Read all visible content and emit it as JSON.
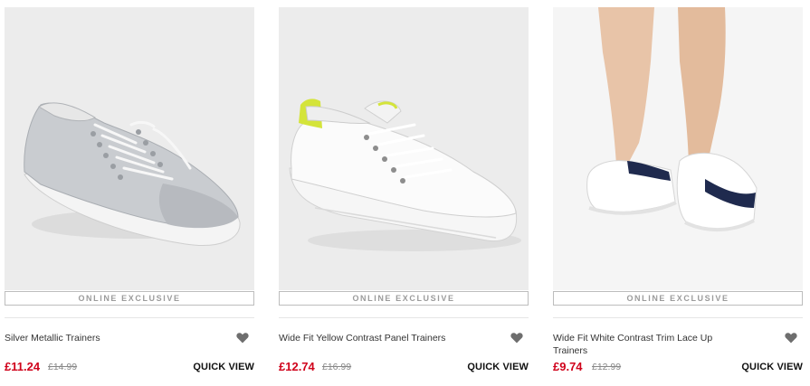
{
  "products": [
    {
      "badge": "ONLINE EXCLUSIVE",
      "title": "Silver Metallic Trainers",
      "price_now": "£11.24",
      "price_was": "£14.99",
      "quick_view": "QUICK VIEW",
      "wishlist_icon": "heart-icon"
    },
    {
      "badge": "ONLINE EXCLUSIVE",
      "title": "Wide Fit Yellow Contrast Panel Trainers",
      "price_now": "£12.74",
      "price_was": "£16.99",
      "quick_view": "QUICK VIEW",
      "wishlist_icon": "heart-icon"
    },
    {
      "badge": "ONLINE EXCLUSIVE",
      "title": "Wide Fit White Contrast Trim Lace Up Trainers",
      "price_now": "£9.74",
      "price_was": "£12.99",
      "quick_view": "QUICK VIEW",
      "wishlist_icon": "heart-icon"
    }
  ],
  "colors": {
    "sale_price": "#d0021b",
    "badge_text": "#9b9b9b",
    "image_background": "#ececec",
    "heart": "#6e6e6e"
  }
}
